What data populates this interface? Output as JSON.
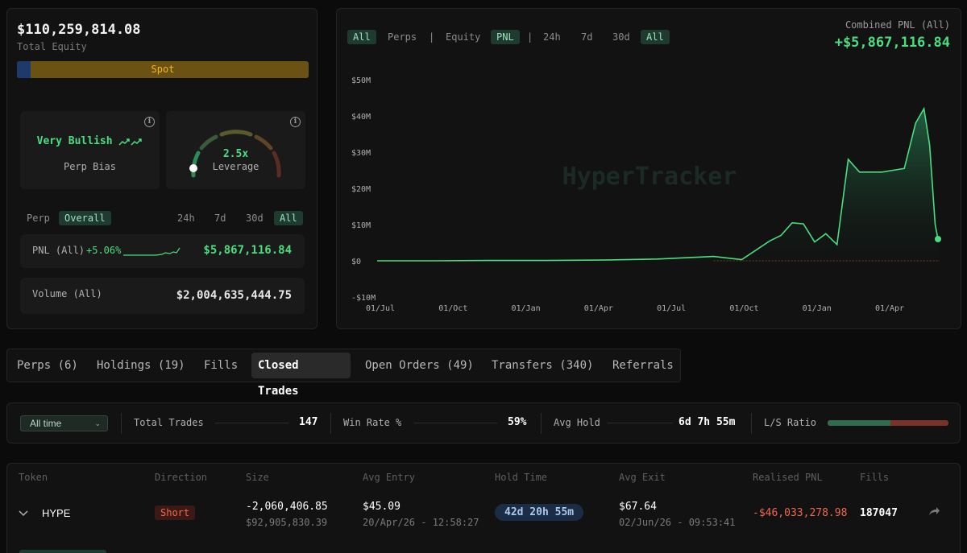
{
  "account": {
    "total_equity": "$110,259,814.08",
    "total_equity_label": "Total Equity",
    "spot_label": "Spot",
    "bias_value": "Very Bullish",
    "bias_label": "Perp Bias",
    "leverage_value": "2.5x",
    "leverage_label": "Leverage",
    "leverage_fraction": 0.15
  },
  "filters_left": {
    "perp": "Perp",
    "overall": "Overall",
    "periods": [
      "24h",
      "7d",
      "30d",
      "All"
    ]
  },
  "stats": {
    "pnl_label": "PNL (All)",
    "pnl_pct": "+5.06%",
    "pnl_value": "$5,867,116.84",
    "volume_label": "Volume (All)",
    "volume_value": "$2,004,635,444.75"
  },
  "chart_controls": {
    "all1": "All",
    "perps": "Perps",
    "sep1": "|",
    "equity": "Equity",
    "pnl": "PNL",
    "sep2": "|",
    "p24h": "24h",
    "p7d": "7d",
    "p30d": "30d",
    "all2": "All"
  },
  "combined": {
    "label": "Combined PNL (All)",
    "value": "+$5,867,116.84"
  },
  "watermark": "HyperTracker",
  "chart_data": {
    "type": "area",
    "y_ticks": [
      "$50M",
      "$40M",
      "$30M",
      "$20M",
      "$10M",
      "$0",
      "-$10M"
    ],
    "x_ticks": [
      "01/Jul",
      "01/Oct",
      "01/Jan",
      "01/Apr",
      "01/Jul",
      "01/Oct",
      "01/Jan",
      "01/Apr"
    ],
    "ylim": [
      -10,
      50
    ],
    "y_unit": "$M",
    "x": [
      0,
      0.1,
      0.2,
      0.3,
      0.4,
      0.5,
      0.6,
      0.65,
      0.7,
      0.72,
      0.74,
      0.76,
      0.78,
      0.8,
      0.82,
      0.84,
      0.86,
      0.88,
      0.9,
      0.92,
      0.94,
      0.96,
      0.975,
      0.985,
      0.995,
      1.0
    ],
    "values": [
      0,
      0,
      0.1,
      0.1,
      0.2,
      0.5,
      1.2,
      0.3,
      5.5,
      7,
      10.5,
      10.2,
      5.2,
      7.5,
      4.5,
      28,
      24.5,
      24.5,
      24.5,
      25,
      25.5,
      38,
      42,
      32,
      10,
      6
    ]
  },
  "tabs": [
    "Perps (6)",
    "Holdings (19)",
    "Fills",
    "Closed Trades",
    "Open Orders (49)",
    "Transfers (340)",
    "Referrals"
  ],
  "summary": {
    "range": "All time",
    "total_trades_label": "Total Trades",
    "total_trades": "147",
    "win_rate_label": "Win Rate %",
    "win_rate": "59%",
    "avg_hold_label": "Avg Hold",
    "avg_hold": "6d 7h 55m",
    "ls_label": "L/S Ratio",
    "ls_long_fraction": 0.52
  },
  "table": {
    "headers": [
      "Token",
      "Direction",
      "Size",
      "Avg Entry",
      "Hold Time",
      "Avg Exit",
      "Realised PNL",
      "Fills"
    ],
    "row": {
      "token": "HYPE",
      "direction": "Short",
      "size": "-2,060,406.85",
      "size_usd": "$92,905,830.39",
      "entry": "$45.09",
      "entry_time": "20/Apr/26 - 12:58:27",
      "hold": "42d 20h 55m",
      "exit": "$67.64",
      "exit_time": "02/Jun/26 - 09:53:41",
      "pnl": "-$46,033,278.98",
      "fills": "187047"
    }
  },
  "colors": {
    "accent_green": "#4ade80",
    "negative_red": "#f2664b",
    "spot_bar": "#6b5212",
    "perp_bar": "#1d3a6b"
  }
}
